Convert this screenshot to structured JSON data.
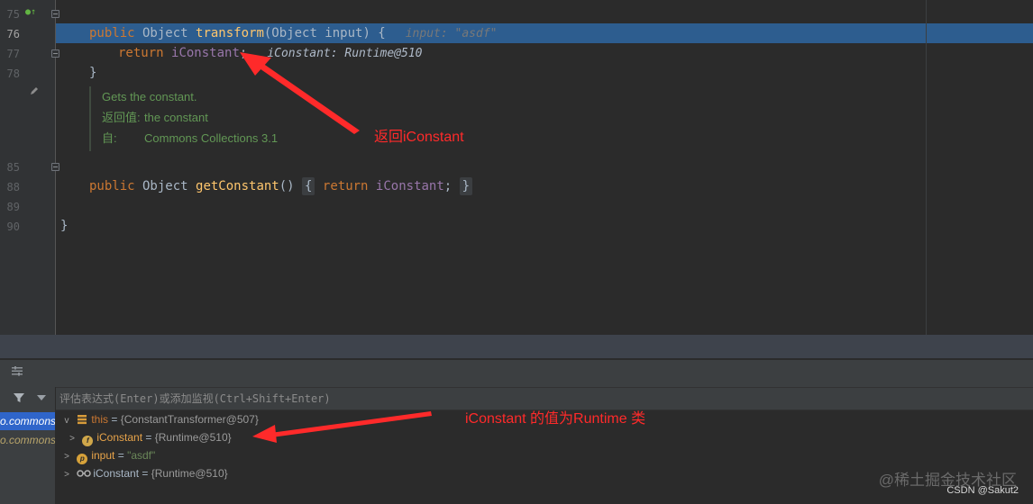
{
  "colors": {
    "accent": "#2f65ca",
    "highlight": "#2d5d8f",
    "annotation": "#ff2a2a",
    "keyword": "#cc7832",
    "method": "#ffc66d",
    "field": "#9876aa",
    "doc": "#629755"
  },
  "editor": {
    "line_numbers": {
      "l75": "75",
      "l76": "76",
      "l77": "77",
      "l78": "78",
      "l85": "85",
      "l88": "88",
      "l89": "89",
      "l90": "90"
    },
    "line1": {
      "kw": "public",
      "t1": " Object ",
      "fn": "transform",
      "t2": "(Object input) {",
      "hint": "input: \"asdf\""
    },
    "line2": {
      "kw": "return",
      "field": "iConstant",
      "semi": ";",
      "hint": "iConstant: Runtime@510"
    },
    "line3": {
      "text": "}"
    },
    "doc": {
      "summary": "Gets the constant.",
      "return_key": "返回值:",
      "return_val": "the constant",
      "from_key": "自:",
      "from_val": "Commons Collections 3.1"
    },
    "line85": {
      "kw": "public",
      "t1": " Object ",
      "fn": "getConstant",
      "t2": "() ",
      "open": "{",
      "kw2": "return",
      "field": "iConstant",
      "semi": ";",
      "close": "}"
    },
    "line89": {
      "text": "}"
    }
  },
  "annotations": {
    "a1": "返回iConstant",
    "a2": "iConstant 的值为Runtime 类"
  },
  "debug": {
    "eval_placeholder": "评估表达式(Enter)或添加监视(Ctrl+Shift+Enter)",
    "frames": [
      {
        "label": "o.commons."
      },
      {
        "label": "o.commons"
      }
    ],
    "vars": [
      {
        "twisty": "v",
        "name": "this",
        "eq": " = ",
        "value": "{ConstantTransformer@507}"
      },
      {
        "twisty": ">",
        "icon": "f",
        "name": "iConstant",
        "eq": " = ",
        "value": "{Runtime@510}"
      },
      {
        "twisty": ">",
        "icon": "p",
        "name": "input",
        "eq": " = ",
        "value": "\"asdf\""
      },
      {
        "twisty": ">",
        "icon": "oo",
        "name": "iConstant",
        "eq": " = ",
        "value": "{Runtime@510}"
      }
    ]
  },
  "watermark": {
    "main": "@稀土掘金技术社区",
    "sub": "CSDN @Sakut2"
  }
}
